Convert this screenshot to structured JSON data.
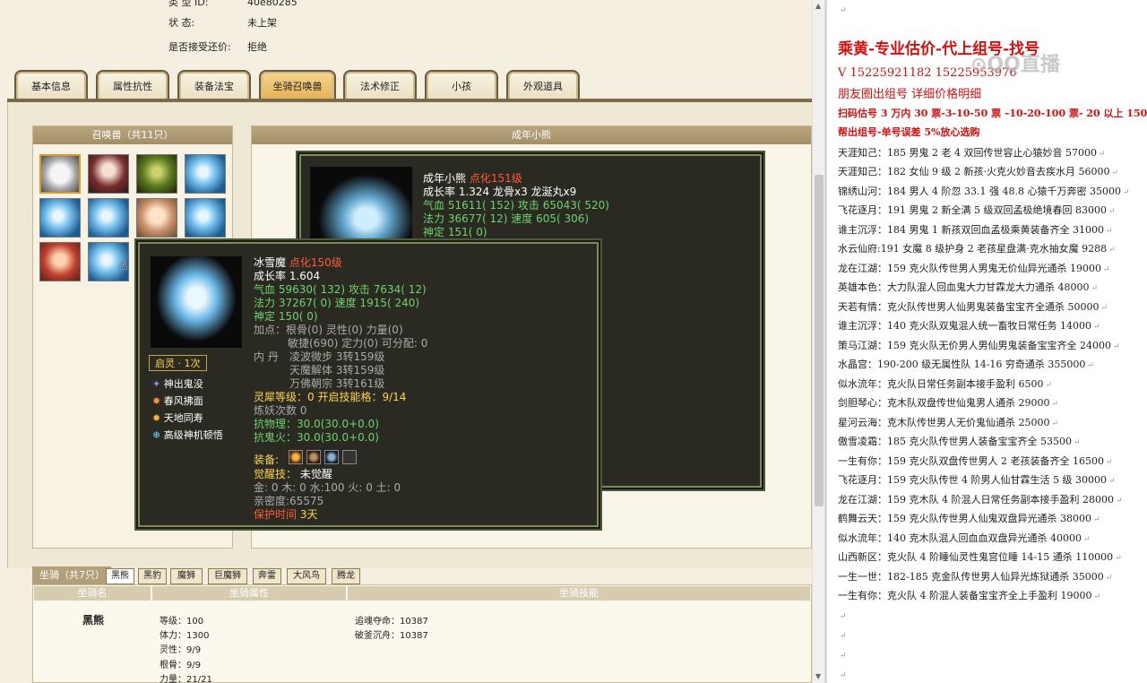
{
  "info": {
    "row1_label": "类  型  ID:",
    "row1_value": "40e80285",
    "row2_label": "状      态:",
    "row2_value": "未上架",
    "row3_label": "是否接受还价:",
    "row3_value": "拒绝"
  },
  "tabs": [
    "基本信息",
    "属性抗性",
    "装备法宝",
    "坐骑召唤兽",
    "法术修正",
    "小孩",
    "外观道具"
  ],
  "active_tab": "坐骑召唤兽",
  "pets_panel": {
    "title": "召唤兽（共11只）"
  },
  "detail_panel": {
    "title": "成年小熊"
  },
  "tip_bear": {
    "name": "成年小熊",
    "name_tag": "点化151级",
    "growth": "成长率 1.324 龙骨x3 龙涎丸x9",
    "hp": "气血 51611( 152) 攻击 65043( 520)",
    "mp": "法力 36677( 12) 速度 605( 306)",
    "shen": "神定 151( 0)",
    "partial": "加点：根骨(0) 灵性(0) 力量(0)"
  },
  "tip_ice": {
    "name": "冰雪魔",
    "name_tag": "点化150级",
    "growth": "成长率 1.604",
    "hp": "气血 59630( 132) 攻击 7634( 12)",
    "mp": "法力 37267( 0) 速度 1915( 240)",
    "shen": "神定 150( 0)",
    "points1": "加点：根骨(0) 灵性(0) 力量(0)",
    "points2": "敏捷(690) 定力(0) 可分配: 0",
    "neidan_label": "内  丹",
    "neidan1": "凌波微步 3转159级",
    "neidan2": "天魔解体 3转159级",
    "neidan3": "万佛朝宗 3转161级",
    "lingxi": "灵犀等级：0 开启技能格：9/14",
    "lianyao": "炼妖次数 0",
    "kangwuli": "抗物理：30.0(30.0+0.0)",
    "kangguihuo": "抗鬼火：30.0(30.0+0.0)",
    "zhuangbei": "装备:",
    "juexing_label": "觉醒技：",
    "juexing_value": "未觉醒",
    "wuxing": "金: 0 木: 0 水:100 火: 0 土: 0",
    "qinmi": "亲密度:65575",
    "baohu_label": "保护时间",
    "baohu_value": "3天",
    "qiling": "启灵 · 1次",
    "skills": [
      "神出鬼没",
      "春风拂面",
      "天地同寿",
      "高级神机顿悟"
    ]
  },
  "mount": {
    "title": "坐骑（共7只）",
    "tabs": [
      "黑熊",
      "黑豹",
      "魔狮",
      "巨魔狮",
      "奔雷",
      "大风鸟",
      "腾龙"
    ],
    "headers": {
      "name": "坐骑名",
      "attr": "坐骑属性",
      "skill": "坐骑技能"
    },
    "name": "黑熊",
    "attrs": [
      "等级：100",
      "体力：1300",
      "灵性：9/9",
      "根骨：9/9",
      "力量：21/21"
    ],
    "skills": [
      "追魂夺命：10387",
      "破釜沉舟：10387"
    ]
  },
  "notes": {
    "title": "乘黄-专业估价-代上组号-找号",
    "phone": "V 15225921182   15225953976",
    "sub": "朋友圈出组号    详细价格明细",
    "price1": "扫码估号 3 万内 30 票-3-10-50 票  –10-20-100 票- 20 以上 150",
    "price2": "帮出组号-单号误差 5%放心选购",
    "lines": [
      "天涯知己：185 男鬼 2 老 4 双回传世容止心猿妙音 57000",
      "天涯知己：182 女仙 9 级 2 新孩·火克火妙音去疾水月 56000",
      "锦绣山河：184 男人 4 阶忽 33.1 强 48.8 心猿千万奔密 35000",
      "飞花逐月：191 男鬼 2 新全满 5 级双回孟极绝境春回 83000",
      "谁主沉浮：184 男鬼 1 新孩双回血孟极乘黄装备齐全 31000",
      "水云仙府:191 女魔 8 级护身 2 老孩星盘满·克水抽女魔 9288",
      "龙在江湖：159 克火队传世男人男鬼无价仙异光通杀 19000",
      "英雄本色：大力队混人回血鬼大力甘霖龙大力通杀 48000",
      "天若有情：克火队传世男人仙男鬼装备宝宝齐全通杀 50000",
      "谁主沉浮：140 克火队双鬼混人统一畜牧日常任务 14000",
      "策马江湖：159 克火队无价男人男仙男鬼装备宝宝齐全 24000",
      "水晶宫：190-200 级无属性队 14-16 穷奇通杀 355000",
      "似水流年：克火队日常任务副本接手盈利 6500",
      "剑胆琴心：克木队双盘传世仙鬼男人通杀 29000",
      "星河云海：克木队传世男人无价鬼仙通杀 25000",
      "傲雪凌霜：185 克火队传世男人装备宝宝齐全 53500",
      "一生有你：159 克火队双盘传世男人 2 老孩装备齐全 16500",
      "飞花逐月：159 克火队传世 4 阶男人仙甘霖生活 5 级 30000",
      "龙在江湖：159 克木队 4 阶混人日常任务副本接手盈利 28000",
      "鹤舞云天：159 克火队传世男人仙鬼双盘异光通杀 38000",
      "似水流年：140 克木队混人回血血双盘异光通杀 40000",
      "山西新区：克火队 4 阶睡仙灵性鬼宫位睡 14-15 通杀 110000",
      "一生一世：182-185 克金队传世男人仙异光炼狱通杀 35000",
      "一生有你：克火队 4 阶混人装备宝宝齐全上手盈利 19000"
    ]
  }
}
